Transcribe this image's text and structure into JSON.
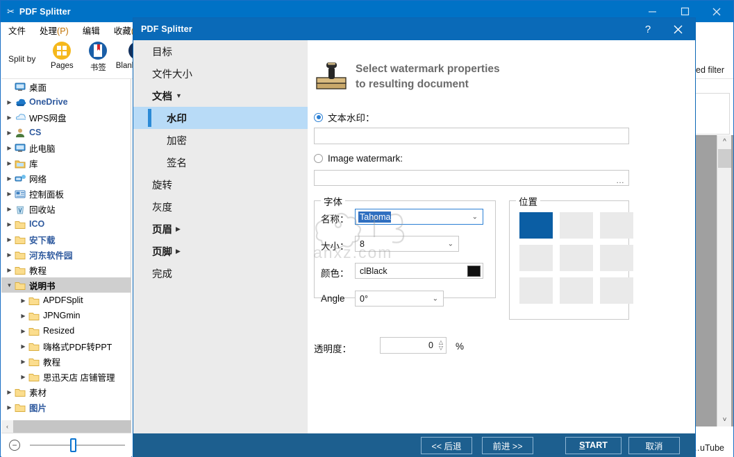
{
  "app": {
    "title": "PDF Splitter",
    "title_icon": "scissors-icon",
    "window_controls": {
      "minimize": "—",
      "maximize": "□",
      "close": "✕"
    },
    "menu": [
      {
        "label": "文件"
      },
      {
        "label": "处理",
        "mnemonic": "(P)"
      },
      {
        "label": "编辑"
      },
      {
        "label": "收藏",
        "mnemonic": "(F"
      }
    ],
    "toolbar": {
      "split_by_label": "Split by",
      "buttons": [
        {
          "label": "Pages",
          "icon": "grid-pages-icon"
        },
        {
          "label": "书签",
          "icon": "bookmark-icon"
        },
        {
          "label": "Blank pages",
          "icon": "blank-page-icon"
        }
      ]
    },
    "background_text": {
      "advanced_filter": "…ced filter",
      "youtube": "…uTube"
    },
    "zoom_slider": {
      "minus_icon": "minus-circle-icon",
      "value": ""
    },
    "hscroll": {
      "left_arrow": "‹"
    }
  },
  "tree": {
    "items": [
      {
        "label": "桌面",
        "icon": "monitor-icon",
        "indent": 0,
        "twisty": "",
        "style": "plain",
        "selected": false
      },
      {
        "label": "OneDrive",
        "icon": "cloud-icon",
        "indent": 0,
        "twisty": "▶",
        "style": "blue",
        "selected": false
      },
      {
        "label": "WPS网盘",
        "icon": "cloud-outline-icon",
        "indent": 0,
        "twisty": "▶",
        "style": "plain",
        "selected": false
      },
      {
        "label": "CS",
        "icon": "user-icon",
        "indent": 0,
        "twisty": "▶",
        "style": "blue",
        "selected": false
      },
      {
        "label": "此电脑",
        "icon": "monitor-icon",
        "indent": 0,
        "twisty": "▶",
        "style": "plain",
        "selected": false
      },
      {
        "label": "库",
        "icon": "library-icon",
        "indent": 0,
        "twisty": "▶",
        "style": "plain",
        "selected": false
      },
      {
        "label": "网络",
        "icon": "network-icon",
        "indent": 0,
        "twisty": "▶",
        "style": "plain",
        "selected": false
      },
      {
        "label": "控制面板",
        "icon": "control-panel-icon",
        "indent": 0,
        "twisty": "▶",
        "style": "plain",
        "selected": false
      },
      {
        "label": "回收站",
        "icon": "recycle-bin-icon",
        "indent": 0,
        "twisty": "▶",
        "style": "plain",
        "selected": false
      },
      {
        "label": "ICO",
        "icon": "folder-icon",
        "indent": 0,
        "twisty": "▶",
        "style": "blue",
        "selected": false
      },
      {
        "label": "安下载",
        "icon": "folder-icon",
        "indent": 0,
        "twisty": "▶",
        "style": "blue",
        "selected": false
      },
      {
        "label": "河东软件园",
        "icon": "folder-icon",
        "indent": 0,
        "twisty": "▶",
        "style": "blue",
        "selected": false
      },
      {
        "label": "教程",
        "icon": "folder-icon",
        "indent": 0,
        "twisty": "▶",
        "style": "plain",
        "selected": false
      },
      {
        "label": "说明书",
        "icon": "folder-icon",
        "indent": 0,
        "twisty": "▼",
        "style": "bold",
        "selected": true
      },
      {
        "label": "APDFSplit",
        "icon": "folder-icon",
        "indent": 1,
        "twisty": "▶",
        "style": "plain",
        "selected": false
      },
      {
        "label": "JPNGmin",
        "icon": "folder-icon",
        "indent": 1,
        "twisty": "▶",
        "style": "plain",
        "selected": false
      },
      {
        "label": "Resized",
        "icon": "folder-icon",
        "indent": 1,
        "twisty": "▶",
        "style": "plain",
        "selected": false
      },
      {
        "label": "嗨格式PDF转PPT",
        "icon": "folder-icon",
        "indent": 1,
        "twisty": "▶",
        "style": "plain",
        "selected": false
      },
      {
        "label": "教程",
        "icon": "folder-icon",
        "indent": 1,
        "twisty": "▶",
        "style": "plain",
        "selected": false
      },
      {
        "label": "思迅天店 店铺管理",
        "icon": "folder-icon",
        "indent": 1,
        "twisty": "▶",
        "style": "plain",
        "selected": false
      },
      {
        "label": "素材",
        "icon": "folder-icon",
        "indent": 0,
        "twisty": "▶",
        "style": "plain",
        "selected": false
      },
      {
        "label": "图片",
        "icon": "folder-icon",
        "indent": 0,
        "twisty": "▶",
        "style": "blue",
        "selected": false
      }
    ]
  },
  "dialog": {
    "title": "PDF Splitter",
    "help_icon": "?",
    "close_icon": "✕",
    "nav": [
      {
        "label": "目标",
        "level": 1,
        "group": false,
        "caret": "",
        "active": false
      },
      {
        "label": "文件大小",
        "level": 1,
        "group": false,
        "caret": "",
        "active": false
      },
      {
        "label": "文档",
        "level": 1,
        "group": true,
        "caret": "▼",
        "active": false
      },
      {
        "label": "水印",
        "level": 2,
        "group": false,
        "caret": "",
        "active": true
      },
      {
        "label": "加密",
        "level": 2,
        "group": false,
        "caret": "",
        "active": false
      },
      {
        "label": "签名",
        "level": 2,
        "group": false,
        "caret": "",
        "active": false
      },
      {
        "label": "旋转",
        "level": 1,
        "group": false,
        "caret": "",
        "active": false
      },
      {
        "label": "灰度",
        "level": 1,
        "group": false,
        "caret": "",
        "active": false
      },
      {
        "label": "页眉",
        "level": 1,
        "group": true,
        "caret": "▶",
        "active": false
      },
      {
        "label": "页脚",
        "level": 1,
        "group": true,
        "caret": "▶",
        "active": false
      },
      {
        "label": "完成",
        "level": 1,
        "group": false,
        "caret": "",
        "active": false
      }
    ],
    "header": {
      "icon": "rubber-stamp-icon",
      "line1": "Select watermark properties",
      "line2": "to resulting document"
    },
    "text_watermark": {
      "label": "文本水印：",
      "selected": true,
      "value": "",
      "placeholder": ""
    },
    "image_watermark": {
      "label": "Image watermark:",
      "selected": false,
      "value": "",
      "placeholder": "",
      "browse_label": "…"
    },
    "font_group": {
      "legend": "字体",
      "name_label": "名称：",
      "name_value": "Tahoma",
      "size_label": "大小：",
      "size_value": "8",
      "color_label": "颜色：",
      "color_value": "clBlack",
      "color_hex": "#111111",
      "angle_label": "Angle",
      "angle_value": "0°"
    },
    "position_group": {
      "legend": "位置",
      "cells": [
        {
          "selected": true
        },
        {
          "selected": false
        },
        {
          "selected": false
        },
        {
          "selected": false
        },
        {
          "selected": false
        },
        {
          "selected": false
        },
        {
          "selected": false
        },
        {
          "selected": false
        },
        {
          "selected": false
        }
      ],
      "selected_color": "#0b5ea4"
    },
    "opacity": {
      "label": "透明度：",
      "value": "0",
      "unit": "%"
    },
    "footer": {
      "back": "<< 后退",
      "next": "前进 >>",
      "start": "START",
      "start_mnemonic": "S",
      "start_rest": "TART",
      "cancel": "取消"
    },
    "accent": "#0a6ab8",
    "footer_bg": "#1d5f8f"
  }
}
